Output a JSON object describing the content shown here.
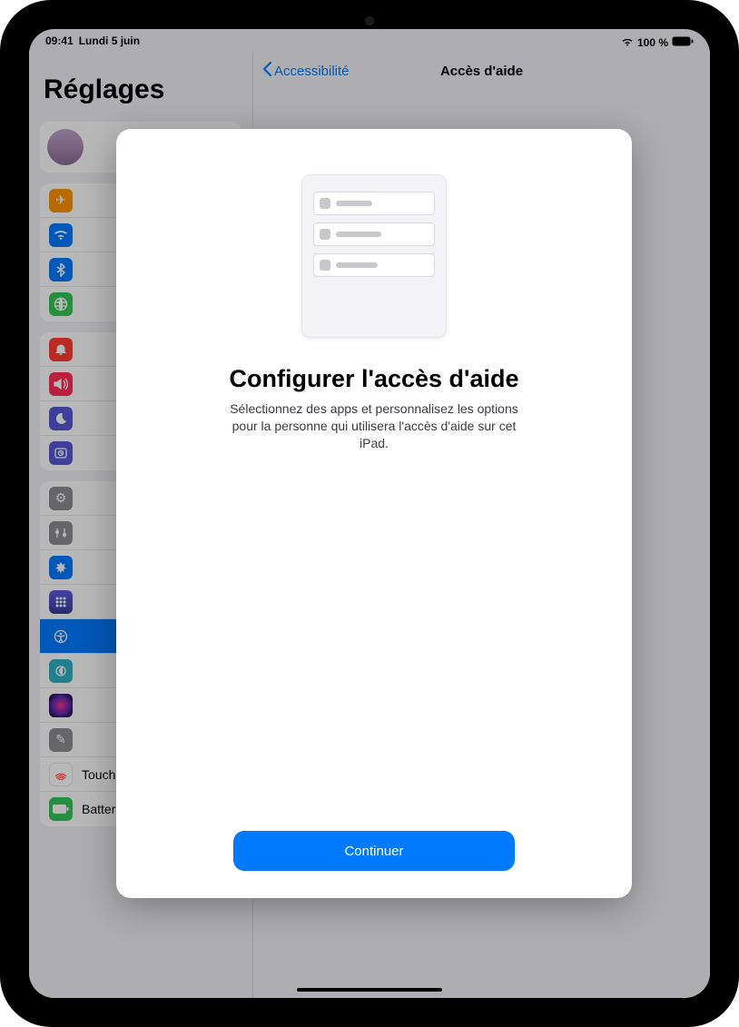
{
  "status": {
    "time": "09:41",
    "date": "Lundi 5 juin",
    "battery_pct": "100 %"
  },
  "sidebar": {
    "title": "Réglages",
    "items": [
      {
        "label": "Touch ID et code",
        "color": "#fff",
        "iconBg": "#fff",
        "iconColor": "#ff3b30"
      },
      {
        "label": "Batterie",
        "color": "#fff",
        "iconBg": "#34c759"
      }
    ]
  },
  "detail": {
    "back_label": "Accessibilité",
    "title": "Accès d'aide"
  },
  "modal": {
    "title": "Configurer l'accès d'aide",
    "subtitle": "Sélectionnez des apps et personnalisez les options pour la personne qui utilisera l'accès d'aide sur cet iPad.",
    "primary": "Continuer"
  },
  "icon_colors": {
    "airplane": "#ff9500",
    "wifi": "#007aff",
    "bluetooth": "#007aff",
    "cellular": "#34c759",
    "notifications": "#ff3b30",
    "sound": "#ff3b30",
    "focus": "#5856d6",
    "screentime": "#5856d6",
    "general": "#8e8e93",
    "controlcenter": "#8e8e93",
    "display": "#007aff",
    "homescreen": "#3355ff",
    "accessibility": "#007aff",
    "wallpaper": "#30b0c7",
    "siri": "#000000",
    "pencil": "#8e8e93",
    "touchid": "#ffffff",
    "battery": "#34c759"
  }
}
